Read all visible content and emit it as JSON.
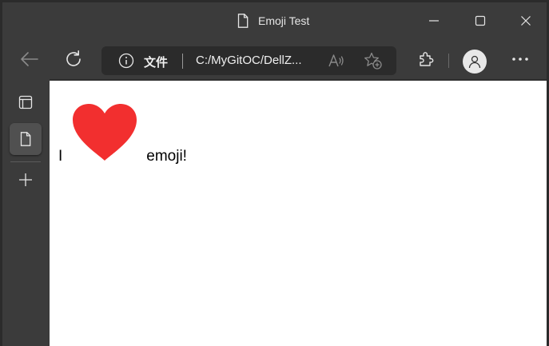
{
  "window": {
    "title": "Emoji Test"
  },
  "address_bar": {
    "file_label": "文件",
    "url": "C:/MyGitOC/DellZ..."
  },
  "page": {
    "word_before": "I",
    "emoji": "heart",
    "word_after": "emoji!"
  },
  "colors": {
    "chrome_bg": "#3b3b3b",
    "address_bg": "#2b2b2b",
    "page_bg": "#ffffff",
    "heart": "#f22f2f"
  }
}
